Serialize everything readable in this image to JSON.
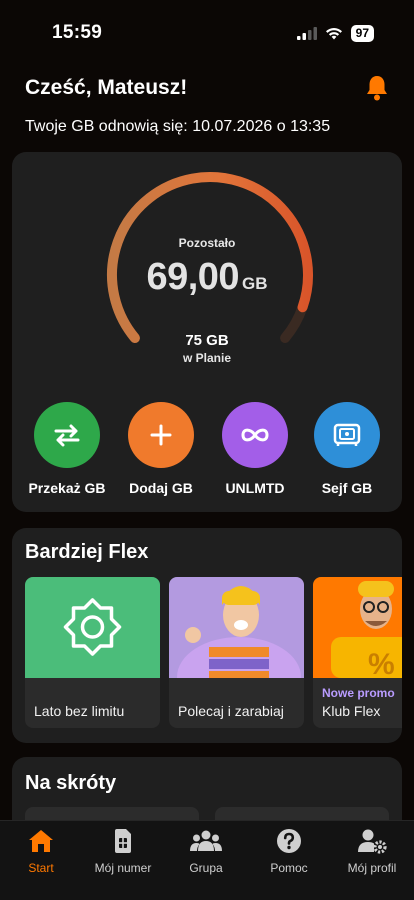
{
  "status": {
    "time": "15:59",
    "battery": "97"
  },
  "header": {
    "greeting": "Cześć, Mateusz!",
    "renew_text": "Twoje GB odnowią się: 10.07.2026 o 13:35"
  },
  "data_usage": {
    "remaining_label": "Pozostało",
    "remaining_value": "69,00",
    "remaining_unit": "GB",
    "plan_amount": "75 GB",
    "plan_label": "w Planie",
    "remaining_fraction": 0.92
  },
  "actions": [
    {
      "label": "Przekaż GB",
      "icon": "transfer-icon",
      "color": "#2ea84a"
    },
    {
      "label": "Dodaj GB",
      "icon": "plus-icon",
      "color": "#f07a2c"
    },
    {
      "label": "UNLMTD",
      "icon": "infinity-icon",
      "color": "#a35ee8"
    },
    {
      "label": "Sejf GB",
      "icon": "safe-icon",
      "color": "#2e8fd8"
    }
  ],
  "flex_section": {
    "title": "Bardziej Flex",
    "promos": [
      {
        "title": "Lato bez limitu",
        "tag": "",
        "color": "#4bbd7a"
      },
      {
        "title": "Polecaj i zarabiaj",
        "tag": "",
        "color": "#b39ae0"
      },
      {
        "title": "Klub Flex",
        "tag": "Nowe promo",
        "color": "#ff7900"
      }
    ]
  },
  "shortcuts": {
    "title": "Na skróty"
  },
  "nav": [
    {
      "label": "Start",
      "icon": "home-icon",
      "active": true
    },
    {
      "label": "Mój numer",
      "icon": "sim-card-icon",
      "active": false
    },
    {
      "label": "Grupa",
      "icon": "group-icon",
      "active": false
    },
    {
      "label": "Pomoc",
      "icon": "help-icon",
      "active": false
    },
    {
      "label": "Mój profil",
      "icon": "profile-settings-icon",
      "active": false
    }
  ],
  "colors": {
    "accent": "#ff7900",
    "background": "#0b0705",
    "card": "#1f1f1f"
  }
}
